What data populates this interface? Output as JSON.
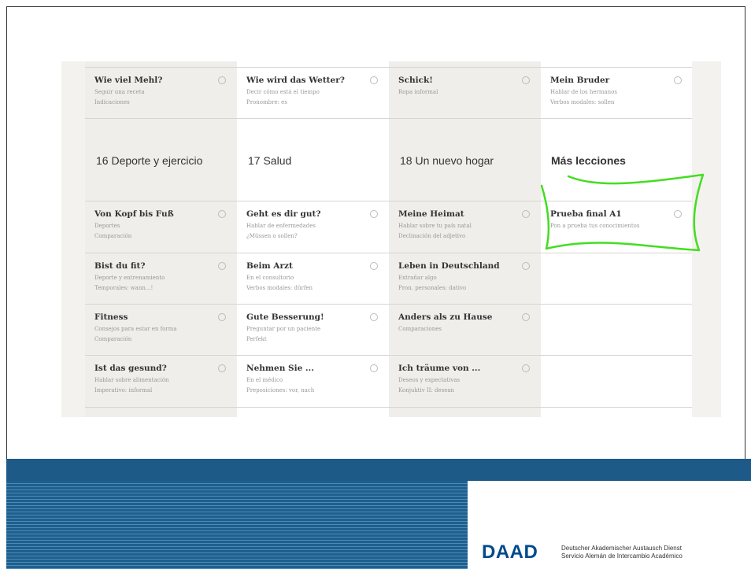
{
  "top_row": [
    {
      "title": "Wie viel Mehl?",
      "lines": [
        "Seguir una receta",
        "Indicaciones"
      ]
    },
    {
      "title": "Wie wird das Wetter?",
      "lines": [
        "Decir cómo está el tiempo",
        "Pronombre: es"
      ]
    },
    {
      "title": "Schick!",
      "lines": [
        "Ropa informal",
        ""
      ]
    },
    {
      "title": "Mein Bruder",
      "lines": [
        "Hablar de los hermanos",
        "Verbos modales: sollen"
      ]
    }
  ],
  "headings": [
    "16 Deporte y ejercicio",
    "17 Salud",
    "18 Un nuevo hogar",
    "Más lecciones"
  ],
  "columns": [
    [
      {
        "title": "Von Kopf bis Fuß",
        "lines": [
          "Deportes",
          "Comparación"
        ]
      },
      {
        "title": "Bist du fit?",
        "lines": [
          "Deporte y entrenamiento",
          "Temporales: wann...!"
        ]
      },
      {
        "title": "Fitness",
        "lines": [
          "Consejos para estar en forma",
          "Comparación"
        ]
      },
      {
        "title": "Ist das gesund?",
        "lines": [
          "Hablar sobre alimentación",
          "Imperativo: informal"
        ]
      }
    ],
    [
      {
        "title": "Geht es dir gut?",
        "lines": [
          "Hablar de enfermedades",
          "¿Müssen o sollen?"
        ]
      },
      {
        "title": "Beim Arzt",
        "lines": [
          "En el consultorio",
          "Verbos modales: dürfen"
        ]
      },
      {
        "title": "Gute Besserung!",
        "lines": [
          "Preguntar por un paciente",
          "Perfekt"
        ]
      },
      {
        "title": "Nehmen Sie ...",
        "lines": [
          "En el médico",
          "Preposiciones: vor, nach"
        ]
      }
    ],
    [
      {
        "title": "Meine Heimat",
        "lines": [
          "Hablar sobre tu país natal",
          "Declinación del adjetivo"
        ]
      },
      {
        "title": "Leben in Deutschland",
        "lines": [
          "Extrañar algo",
          "Pron. personales: dativo"
        ]
      },
      {
        "title": "Anders als zu Hause",
        "lines": [
          "Comparaciones",
          ""
        ]
      },
      {
        "title": "Ich träume von ...",
        "lines": [
          "Deseos y expectativas",
          "Konjuktiv II: desean"
        ]
      }
    ],
    [
      {
        "title": "Prueba final A1",
        "lines": [
          "Pon a prueba tus conocimientos",
          ""
        ]
      }
    ]
  ],
  "footer": {
    "logo": "DAAD",
    "org_line1": "Deutscher Akademischer Austausch Dienst",
    "org_line2": "Servicio Alemán de Intercambio Académico"
  },
  "colors": {
    "stripe": "#1e5f8e",
    "logo": "#004a8c",
    "annotation": "#44dd22"
  }
}
